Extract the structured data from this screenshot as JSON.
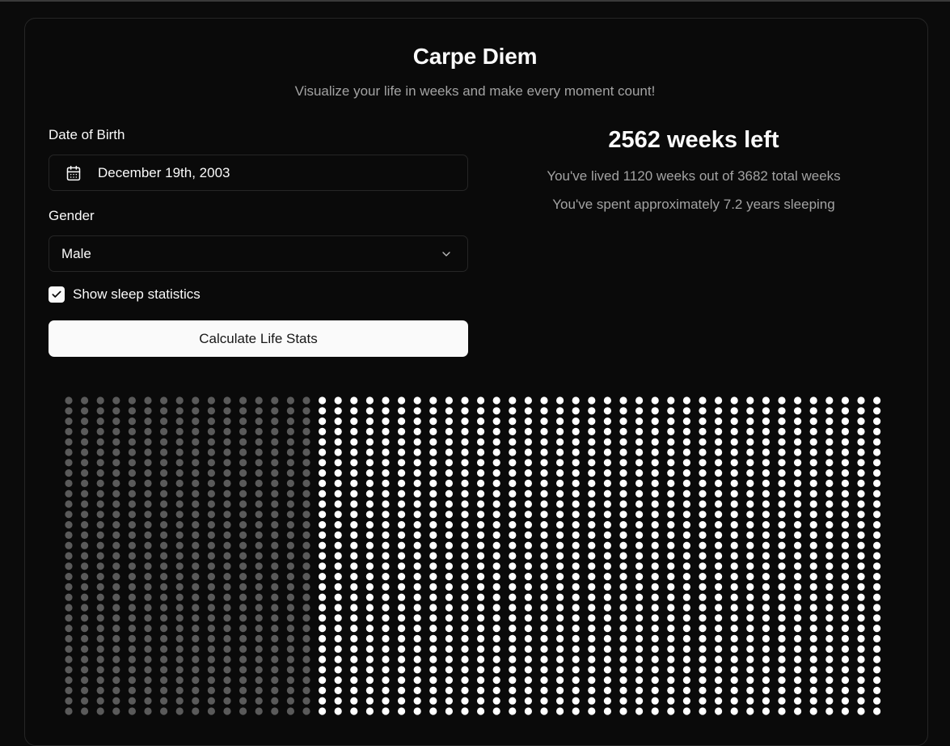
{
  "header": {
    "title": "Carpe Diem",
    "subtitle": "Visualize your life in weeks and make every moment count!"
  },
  "form": {
    "dob_label": "Date of Birth",
    "dob_value": "December 19th, 2003",
    "gender_label": "Gender",
    "gender_value": "Male",
    "sleep_checkbox_label": "Show sleep statistics",
    "sleep_checkbox_checked": true,
    "calculate_button": "Calculate Life Stats"
  },
  "stats": {
    "weeks_left": "2562 weeks left",
    "lived_summary": "You've lived 1120 weeks out of 3682 total weeks",
    "sleep_summary": "You've spent approximately 7.2 years sleeping"
  },
  "week_grid": {
    "lived_weeks": 1120,
    "total_weeks": 3682,
    "lived_color": "#5a5a5a",
    "remaining_color": "#ffffff",
    "icons": {
      "date": "calendar-icon",
      "select": "chevron-down-icon",
      "checkbox": "check-icon"
    }
  }
}
